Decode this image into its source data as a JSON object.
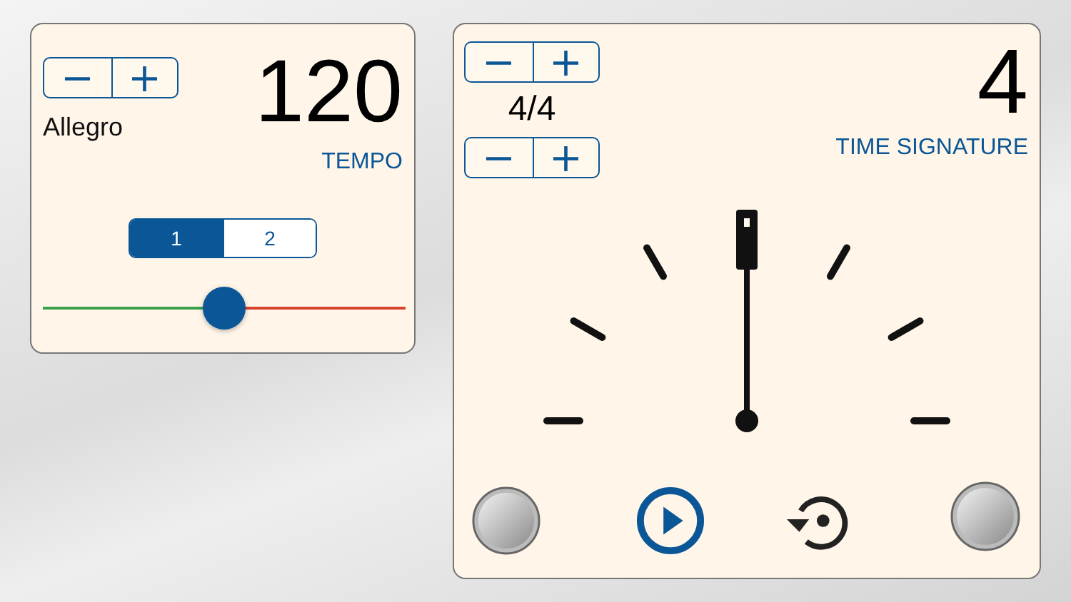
{
  "tempo_panel": {
    "stepper": [
      "−",
      "+"
    ],
    "tempo_name": "Allegro",
    "tempo_value": "120",
    "tempo_label": "TEMPO",
    "segments": [
      {
        "label": "1",
        "selected": true
      },
      {
        "label": "2",
        "selected": false
      }
    ],
    "slider": {
      "level": 0.5
    }
  },
  "time_signature_panel": {
    "top_stepper": [
      "−",
      "+"
    ],
    "signature": "4/4",
    "bottom_stepper": [
      "−",
      "+"
    ],
    "beats": "4",
    "label": "TIME SIGNATURE"
  }
}
